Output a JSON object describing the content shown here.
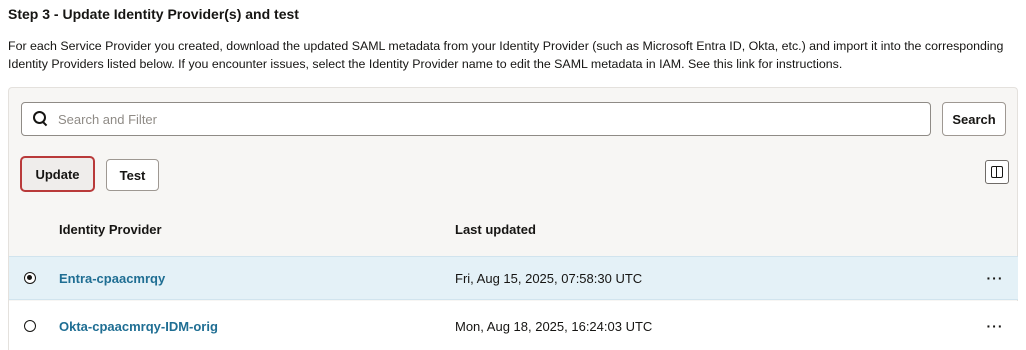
{
  "step": {
    "title": "Step 3 - Update Identity Provider(s) and test",
    "description": "For each Service Provider you created, download the updated SAML metadata from your Identity Provider (such as Microsoft Entra ID, Okta, etc.) and import it into the corresponding Identity Providers listed below. If you encounter issues, select the Identity Provider name to edit the SAML metadata in IAM. See this link for instructions."
  },
  "search": {
    "placeholder": "Search and Filter",
    "value": "",
    "button_label": "Search"
  },
  "toolbar": {
    "update_label": "Update",
    "test_label": "Test",
    "columns_icon": "columns-icon"
  },
  "table": {
    "columns": [
      "Identity Provider",
      "Last updated"
    ],
    "rows": [
      {
        "name": "Entra-cpaacmrqy",
        "last_updated": "Fri, Aug 15, 2025, 07:58:30 UTC",
        "selected": true,
        "actions": "···"
      },
      {
        "name": "Okta-cpaacmrqy-IDM-orig",
        "last_updated": "Mon, Aug 18, 2025, 16:24:03 UTC",
        "selected": false,
        "actions": "···"
      }
    ]
  },
  "colors": {
    "link": "#1f6e93",
    "selected_row": "#e4f1f7",
    "focus_border": "#b93a3a",
    "panel_bg": "#f7f6f4"
  }
}
